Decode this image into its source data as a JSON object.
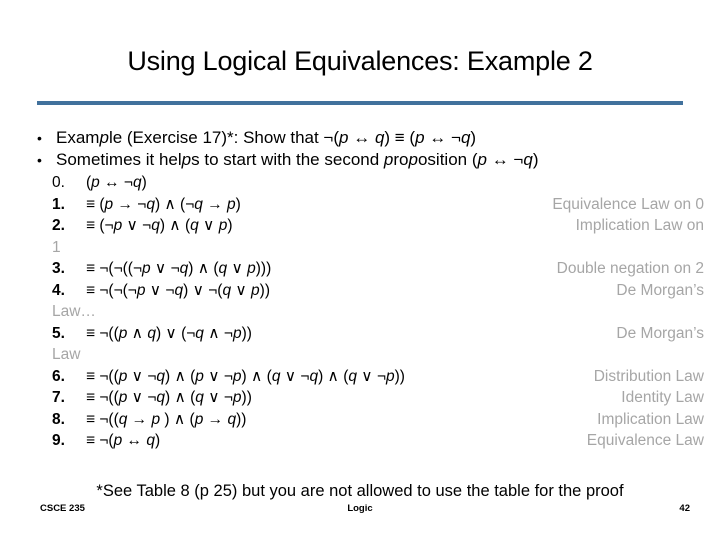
{
  "slide": {
    "title": "Using Logical Equivalences: Example 2",
    "rule_color": "#41719C",
    "law_color": "#A6A6A6"
  },
  "bullets": [
    {
      "marker": "•",
      "text": "Example (Exercise 17)*: Show that ¬(p ↔ q) ≡ (p ↔ ¬q)"
    },
    {
      "marker": "•",
      "text": "Sometimes it helps to start with the second proposition (p ↔ ¬q)"
    }
  ],
  "steps": [
    {
      "num": "0.",
      "expr": "(p ↔ ¬q)",
      "law": ""
    },
    {
      "num": "1.",
      "expr": "≡ (p → ¬q) ∧ (¬q → p)",
      "law": "Equivalence Law on 0"
    },
    {
      "num": "2.",
      "expr": "≡ (¬p ∨ ¬q) ∧ (q ∨ p)",
      "law": "Implication Law on"
    },
    {
      "num": "",
      "expr": "",
      "law": "",
      "overflow": "1"
    },
    {
      "num": "3.",
      "expr": "≡ ¬(¬((¬p ∨ ¬q) ∧ (q ∨ p)))",
      "law": "Double negation on 2"
    },
    {
      "num": "4.",
      "expr": "≡ ¬(¬(¬p ∨ ¬q) ∨ ¬(q ∨ p))",
      "law": "De Morgan’s"
    },
    {
      "num": "",
      "expr": "",
      "law": "",
      "overflow": "Law…"
    },
    {
      "num": "5.",
      "expr": "≡ ¬((p ∧ q) ∨ (¬q ∧ ¬p))",
      "law": "De Morgan’s"
    },
    {
      "num": "",
      "expr": "",
      "law": "",
      "overflow": "Law"
    },
    {
      "num": "6.",
      "expr": "≡ ¬((p ∨ ¬q) ∧ (p ∨ ¬p) ∧ (q ∨ ¬q) ∧  (q ∨ ¬p))",
      "law": "Distribution Law"
    },
    {
      "num": "7.",
      "expr": "≡ ¬((p ∨ ¬q) ∧  (q ∨ ¬p))",
      "law": "Identity Law"
    },
    {
      "num": "8.",
      "expr": "≡ ¬((q → p ) ∧  (p → q))",
      "law": "Implication Law"
    },
    {
      "num": "9.",
      "expr": "≡ ¬(p ↔ q)",
      "law": "Equivalence Law"
    }
  ],
  "footnote": "*See Table 8 (p 25) but you are not allowed to use the table for the proof",
  "footer": {
    "left": "CSCE 235",
    "center": "Logic",
    "right": "42"
  }
}
